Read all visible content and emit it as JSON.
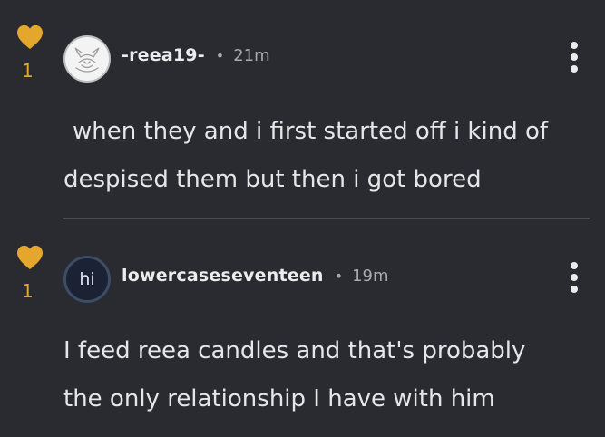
{
  "colors": {
    "background": "#2a2b31",
    "like_accent": "#e4a62c",
    "text_primary": "#e6e6e8",
    "text_secondary": "#a9aab0",
    "divider": "#4a4b52"
  },
  "comments": [
    {
      "likes": "1",
      "like_icon": "heart-icon",
      "avatar_icon": "fox-sketch-avatar",
      "username": "-reea19-",
      "separator": "•",
      "time": "21m",
      "menu_icon": "more-vertical-icon",
      "body_lines": [
        "when they and i first started off i kind of",
        "despised them but then i got bored"
      ]
    },
    {
      "likes": "1",
      "like_icon": "heart-icon",
      "avatar_text": "hi",
      "username": "lowercaseseventeen",
      "separator": "•",
      "time": "19m",
      "menu_icon": "more-vertical-icon",
      "body_lines": [
        "I feed reea candles and that's probably",
        "the only relationship I have with him"
      ]
    }
  ]
}
